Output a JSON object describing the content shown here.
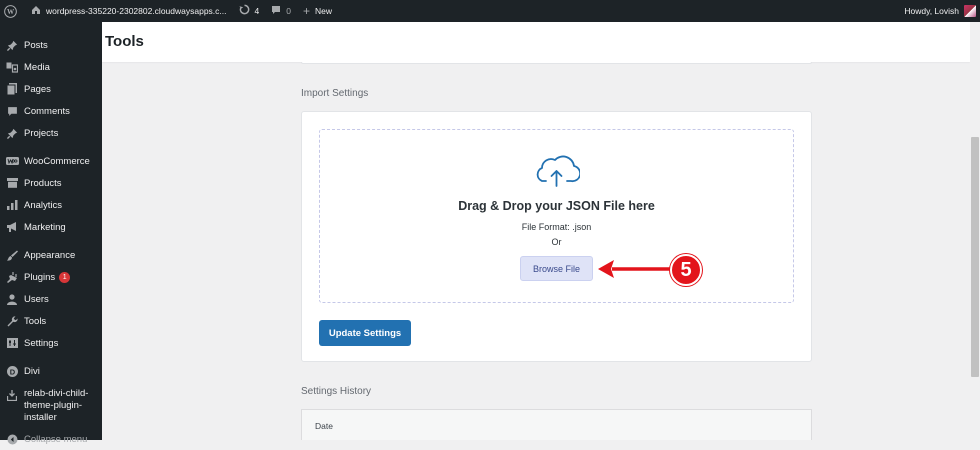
{
  "adminbar": {
    "site_name": "wordpress-335220-2302802.cloudwaysapps.c...",
    "updates_count": "4",
    "comments_count": "0",
    "new_label": "New",
    "howdy": "Howdy, Lovish"
  },
  "sidebar": {
    "items": [
      {
        "label": "Posts",
        "icon": "pin-icon"
      },
      {
        "label": "Media",
        "icon": "media-icon"
      },
      {
        "label": "Pages",
        "icon": "pages-icon"
      },
      {
        "label": "Comments",
        "icon": "comment-icon"
      },
      {
        "label": "Projects",
        "icon": "pin-icon"
      },
      {
        "label": "WooCommerce",
        "icon": "woo-icon"
      },
      {
        "label": "Products",
        "icon": "archive-icon"
      },
      {
        "label": "Analytics",
        "icon": "bar-chart-icon"
      },
      {
        "label": "Marketing",
        "icon": "megaphone-icon"
      },
      {
        "label": "Appearance",
        "icon": "brush-icon"
      },
      {
        "label": "Plugins",
        "icon": "plug-icon",
        "badge": "1"
      },
      {
        "label": "Users",
        "icon": "user-icon"
      },
      {
        "label": "Tools",
        "icon": "wrench-icon"
      },
      {
        "label": "Settings",
        "icon": "settings-icon"
      },
      {
        "label": "Divi",
        "icon": "divi-icon"
      },
      {
        "label": "relab-divi-child-theme-plugin-installer",
        "label_lines": [
          "relab-divi-child-",
          "theme-plugin-",
          "installer"
        ],
        "icon": "plugin-installer-icon"
      },
      {
        "label": "Collapse menu",
        "icon": "collapse-icon"
      }
    ]
  },
  "header": {
    "title": "Tools"
  },
  "import": {
    "section_label": "Import Settings",
    "drop_title": "Drag & Drop your JSON File here",
    "file_format": "File Format: .json",
    "or": "Or",
    "browse_label": "Browse File",
    "update_label": "Update Settings"
  },
  "annotation": {
    "step_number": "5",
    "color": "#e3141b"
  },
  "history": {
    "section_label": "Settings History",
    "columns": [
      "Date"
    ]
  },
  "colors": {
    "adminbar_bg": "#1d2327",
    "primary_button": "#2271b1",
    "browse_button_bg": "#dfe3f7",
    "badge": "#d63638"
  }
}
